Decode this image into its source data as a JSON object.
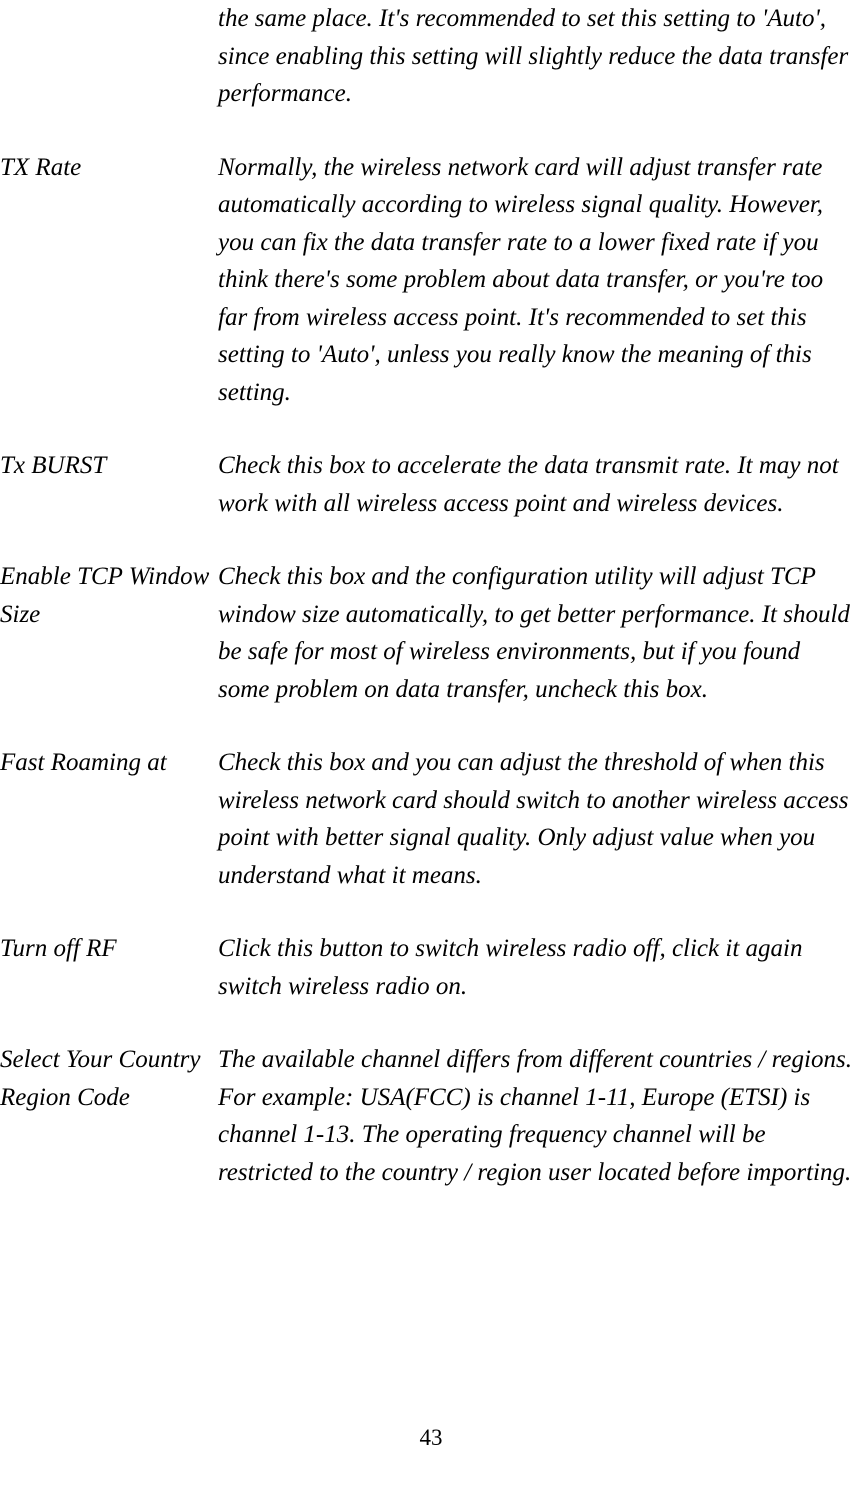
{
  "intro_fragment": "the same place. It's recommended to set this setting to 'Auto', since enabling this setting will slightly reduce the data transfer performance.",
  "rows": [
    {
      "label": "TX Rate",
      "desc": "Normally, the wireless network card will adjust transfer rate automatically according to wireless signal quality. However, you can fix the data transfer rate to a lower fixed rate if you think there's some problem about data transfer, or you're too far from wireless access point. It's recommended to set this setting to 'Auto', unless you really know the meaning of this setting."
    },
    {
      "label": "Tx BURST",
      "desc": "Check this box to accelerate the data transmit rate. It may not work with all wireless access point and wireless devices."
    },
    {
      "label": "Enable TCP Window Size",
      "desc": "Check this box and the configuration utility will adjust TCP window size automatically, to get better performance. It should be safe for most of wireless environments, but if you found some problem on data transfer, uncheck this box."
    },
    {
      "label": "Fast Roaming at",
      "desc": "Check this box and you can adjust the threshold of when this wireless network card should switch to another wireless access point with better signal quality. Only adjust value when you understand what it means."
    },
    {
      "label": "Turn off RF",
      "desc": "Click this button to switch wireless radio off, click it again switch wireless radio on."
    },
    {
      "label": "Select Your Country Region Code",
      "desc": "The available channel differs from different countries / regions. For example: USA(FCC) is channel 1-11, Europe (ETSI) is channel 1-13. The operating frequency channel will be restricted to the country / region user located before importing."
    }
  ],
  "page_number": "43"
}
